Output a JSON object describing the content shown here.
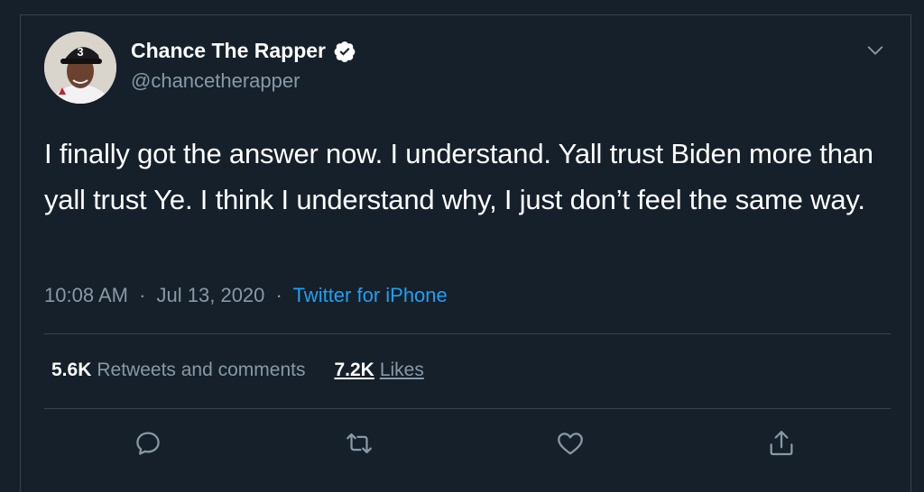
{
  "tweet": {
    "display_name": "Chance The Rapper",
    "handle": "@chancetherapper",
    "text": "I finally got the answer now. I understand. Yall trust Biden more than yall trust Ye. I think I understand why, I just don’t feel the same way.",
    "time": "10:08 AM",
    "separator": "·",
    "date": "Jul 13, 2020",
    "source": "Twitter for iPhone",
    "retweets": {
      "count": "5.6K",
      "label": "Retweets and comments"
    },
    "likes": {
      "count": "7.2K",
      "label": "Likes"
    }
  },
  "colors": {
    "background": "#15202b",
    "border": "#38444d",
    "primary_text": "#ffffff",
    "secondary_text": "#8899a6",
    "accent": "#1da1f2"
  },
  "icons": {
    "verified": "verified-badge-icon",
    "caret": "chevron-down-icon",
    "reply": "reply-icon",
    "retweet": "retweet-icon",
    "like": "heart-icon",
    "share": "share-icon"
  }
}
